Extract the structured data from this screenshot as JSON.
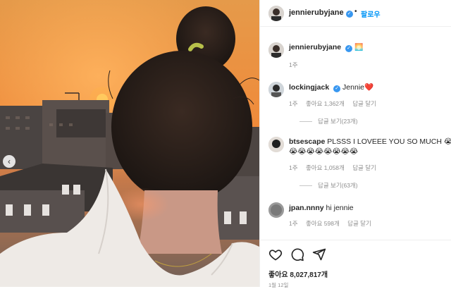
{
  "post": {
    "author": "jennierubyjane",
    "follow_label": "팔로우",
    "caption": {
      "username": "jennierubyjane",
      "emoji": "🌅",
      "time": "1주"
    }
  },
  "comments": [
    {
      "username": "lockingjack",
      "verified": true,
      "text": "Jennie❤️",
      "time": "1주",
      "likes": "좋아요 1,362개",
      "reply": "답글 달기",
      "view_replies": "답글 보기(23개)"
    },
    {
      "username": "btsescape",
      "verified": false,
      "text": "PLSSS I LOVEEE YOU SO MUCH 😭",
      "text_line2": "😭😭😭😭😭😭😭😭",
      "time": "1주",
      "likes": "좋아요 1,058개",
      "reply": "답글 달기",
      "view_replies": "답글 보기(63개)"
    },
    {
      "username": "jpan.nnny",
      "verified": false,
      "text": "hi jennie",
      "time": "1주",
      "likes": "좋아요 598개",
      "reply": "답글 달기"
    }
  ],
  "footer": {
    "likes": "좋아요 8,027,817개",
    "date": "1월 12일"
  },
  "icons": [
    "heart-icon",
    "comment-icon",
    "share-icon",
    "verified-icon",
    "chevron-left-icon"
  ],
  "colors": {
    "link": "#0095f6",
    "verified": "#3897f0",
    "muted": "#8e8e8e"
  }
}
